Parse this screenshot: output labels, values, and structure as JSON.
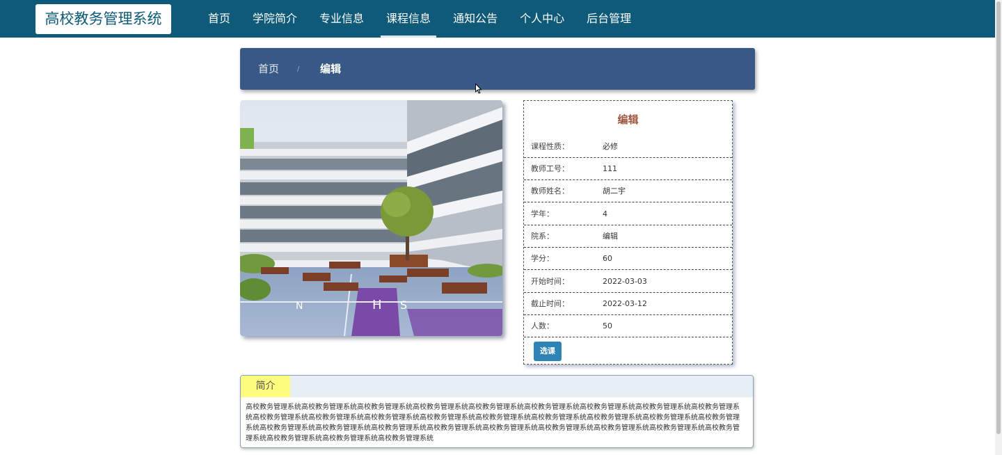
{
  "app": {
    "logo": "高校教务管理系统"
  },
  "nav": {
    "items": [
      {
        "label": "首页",
        "active": false
      },
      {
        "label": "学院简介",
        "active": false
      },
      {
        "label": "专业信息",
        "active": false
      },
      {
        "label": "课程信息",
        "active": true
      },
      {
        "label": "通知公告",
        "active": false
      },
      {
        "label": "个人中心",
        "active": false
      },
      {
        "label": "后台管理",
        "active": false
      }
    ]
  },
  "breadcrumb": {
    "home": "首页",
    "separator": "/",
    "current": "编辑"
  },
  "card": {
    "title": "编辑",
    "rows": [
      {
        "label": "课程性质：",
        "value": "必修"
      },
      {
        "label": "教师工号：",
        "value": "111"
      },
      {
        "label": "教师姓名：",
        "value": "胡二宇"
      },
      {
        "label": "学年：",
        "value": "4"
      },
      {
        "label": "院系：",
        "value": "编辑"
      },
      {
        "label": "学分：",
        "value": "60"
      },
      {
        "label": "开始时间：",
        "value": "2022-03-03"
      },
      {
        "label": "截止时间：",
        "value": "2022-03-12"
      },
      {
        "label": "人数：",
        "value": "50"
      }
    ],
    "button": "选课"
  },
  "intro": {
    "tab": "简介",
    "text": "高校教务管理系统高校教务管理系统高校教务管理系统高校教务管理系统高校教务管理系统高校教务管理系统高校教务管理系统高校教务管理系统高校教务管理系统高校教务管理系统高校教务管理系统高校教务管理系统高校教务管理系统高校教务管理系统高校教务管理系统高校教务管理系统高校教务管理系统高校教务管理系统高校教务管理系统高校教务管理系统高校教务管理系统高校教务管理系统高校教务管理系统高校教务管理系统高校教务管理系统高校教务管理系统高校教务管理系统高校教务管理系统高校教务管理系统高校教务管理系统"
  },
  "colors": {
    "nav_bg": "#0e5a78",
    "breadcrumb_bg": "#385886",
    "title": "#a0573f",
    "button": "#2d82b6",
    "tab_bg": "#fcfc7e"
  }
}
